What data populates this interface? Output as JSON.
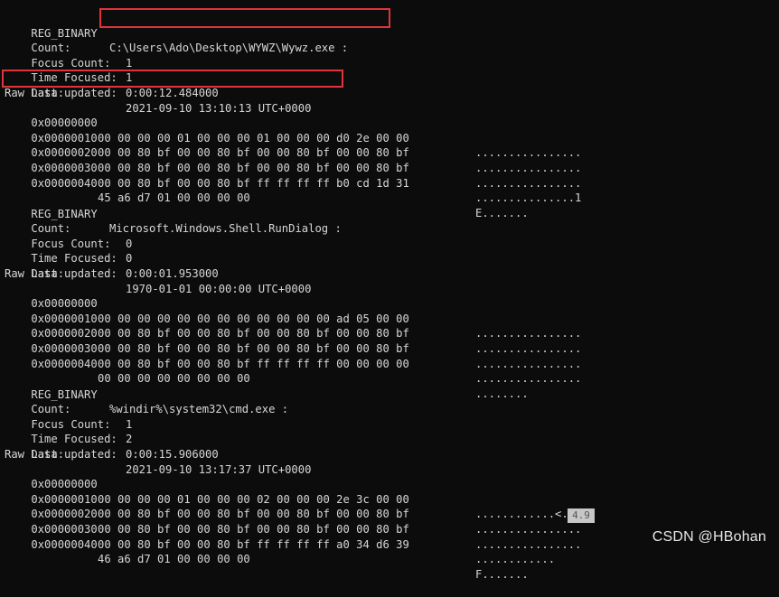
{
  "blocks": [
    {
      "type": "REG_BINARY",
      "path": "C:\\Users\\Ado\\Desktop\\WYWZ\\Wywz.exe :",
      "count_label": "Count:",
      "count": "1",
      "focus_label": "Focus Count:",
      "focus": "1",
      "time_label": "Time Focused:",
      "time": "0:00:12.484000",
      "updated_label": "Last updated:",
      "updated": "2021-09-10 13:10:13 UTC+0000",
      "raw_label": "Raw Data:",
      "rows": [
        {
          "offset": "0x00000000",
          "hex": "00 00 00 00 01 00 00 00 01 00 00 00 d0 2e 00 00",
          "ascii": "................"
        },
        {
          "offset": "0x00000010",
          "hex": "00 00 80 bf 00 00 80 bf 00 00 80 bf 00 00 80 bf",
          "ascii": "................"
        },
        {
          "offset": "0x00000020",
          "hex": "00 00 80 bf 00 00 80 bf 00 00 80 bf 00 00 80 bf",
          "ascii": "................"
        },
        {
          "offset": "0x00000030",
          "hex": "00 00 80 bf 00 00 80 bf ff ff ff ff b0 cd 1d 31",
          "ascii": "...............1"
        },
        {
          "offset": "0x00000040",
          "hex": "45 a6 d7 01 00 00 00 00",
          "ascii": "E......."
        }
      ]
    },
    {
      "type": "REG_BINARY",
      "path": "Microsoft.Windows.Shell.RunDialog :",
      "count_label": "Count:",
      "count": "0",
      "focus_label": "Focus Count:",
      "focus": "0",
      "time_label": "Time Focused:",
      "time": "0:00:01.953000",
      "updated_label": "Last updated:",
      "updated": "1970-01-01 00:00:00 UTC+0000",
      "raw_label": "Raw Data:",
      "rows": [
        {
          "offset": "0x00000000",
          "hex": "00 00 00 00 00 00 00 00 00 00 00 00 ad 05 00 00",
          "ascii": "................"
        },
        {
          "offset": "0x00000010",
          "hex": "00 00 80 bf 00 00 80 bf 00 00 80 bf 00 00 80 bf",
          "ascii": "................"
        },
        {
          "offset": "0x00000020",
          "hex": "00 00 80 bf 00 00 80 bf 00 00 80 bf 00 00 80 bf",
          "ascii": "................"
        },
        {
          "offset": "0x00000030",
          "hex": "00 00 80 bf 00 00 80 bf ff ff ff ff 00 00 00 00",
          "ascii": "................"
        },
        {
          "offset": "0x00000040",
          "hex": "00 00 00 00 00 00 00 00",
          "ascii": "........"
        }
      ]
    },
    {
      "type": "REG_BINARY",
      "path": "%windir%\\system32\\cmd.exe :",
      "count_label": "Count:",
      "count": "1",
      "focus_label": "Focus Count:",
      "focus": "2",
      "time_label": "Time Focused:",
      "time": "0:00:15.906000",
      "updated_label": "Last updated:",
      "updated": "2021-09-10 13:17:37 UTC+0000",
      "raw_label": "Raw Data:",
      "rows": [
        {
          "offset": "0x00000000",
          "hex": "00 00 00 00 01 00 00 00 02 00 00 00 2e 3c 00 00",
          "ascii": "............<.."
        },
        {
          "offset": "0x00000010",
          "hex": "00 00 80 bf 00 00 80 bf 00 00 80 bf 00 00 80 bf",
          "ascii": "................"
        },
        {
          "offset": "0x00000020",
          "hex": "00 00 80 bf 00 00 80 bf 00 00 80 bf 00 00 80 bf",
          "ascii": "................"
        },
        {
          "offset": "0x00000030",
          "hex": "00 00 80 bf 00 00 80 bf ff ff ff ff a0 34 d6 39",
          "ascii": "............"
        },
        {
          "offset": "0x00000040",
          "hex": "46 a6 d7 01 00 00 00 00",
          "ascii": "F......."
        }
      ]
    }
  ],
  "overlay": {
    "patch_text": "4.9",
    "watermark": "CSDN @HBohan"
  },
  "colors": {
    "background": "#0c0c0c",
    "text": "#d7d7d7",
    "highlight": "#e0343a"
  }
}
